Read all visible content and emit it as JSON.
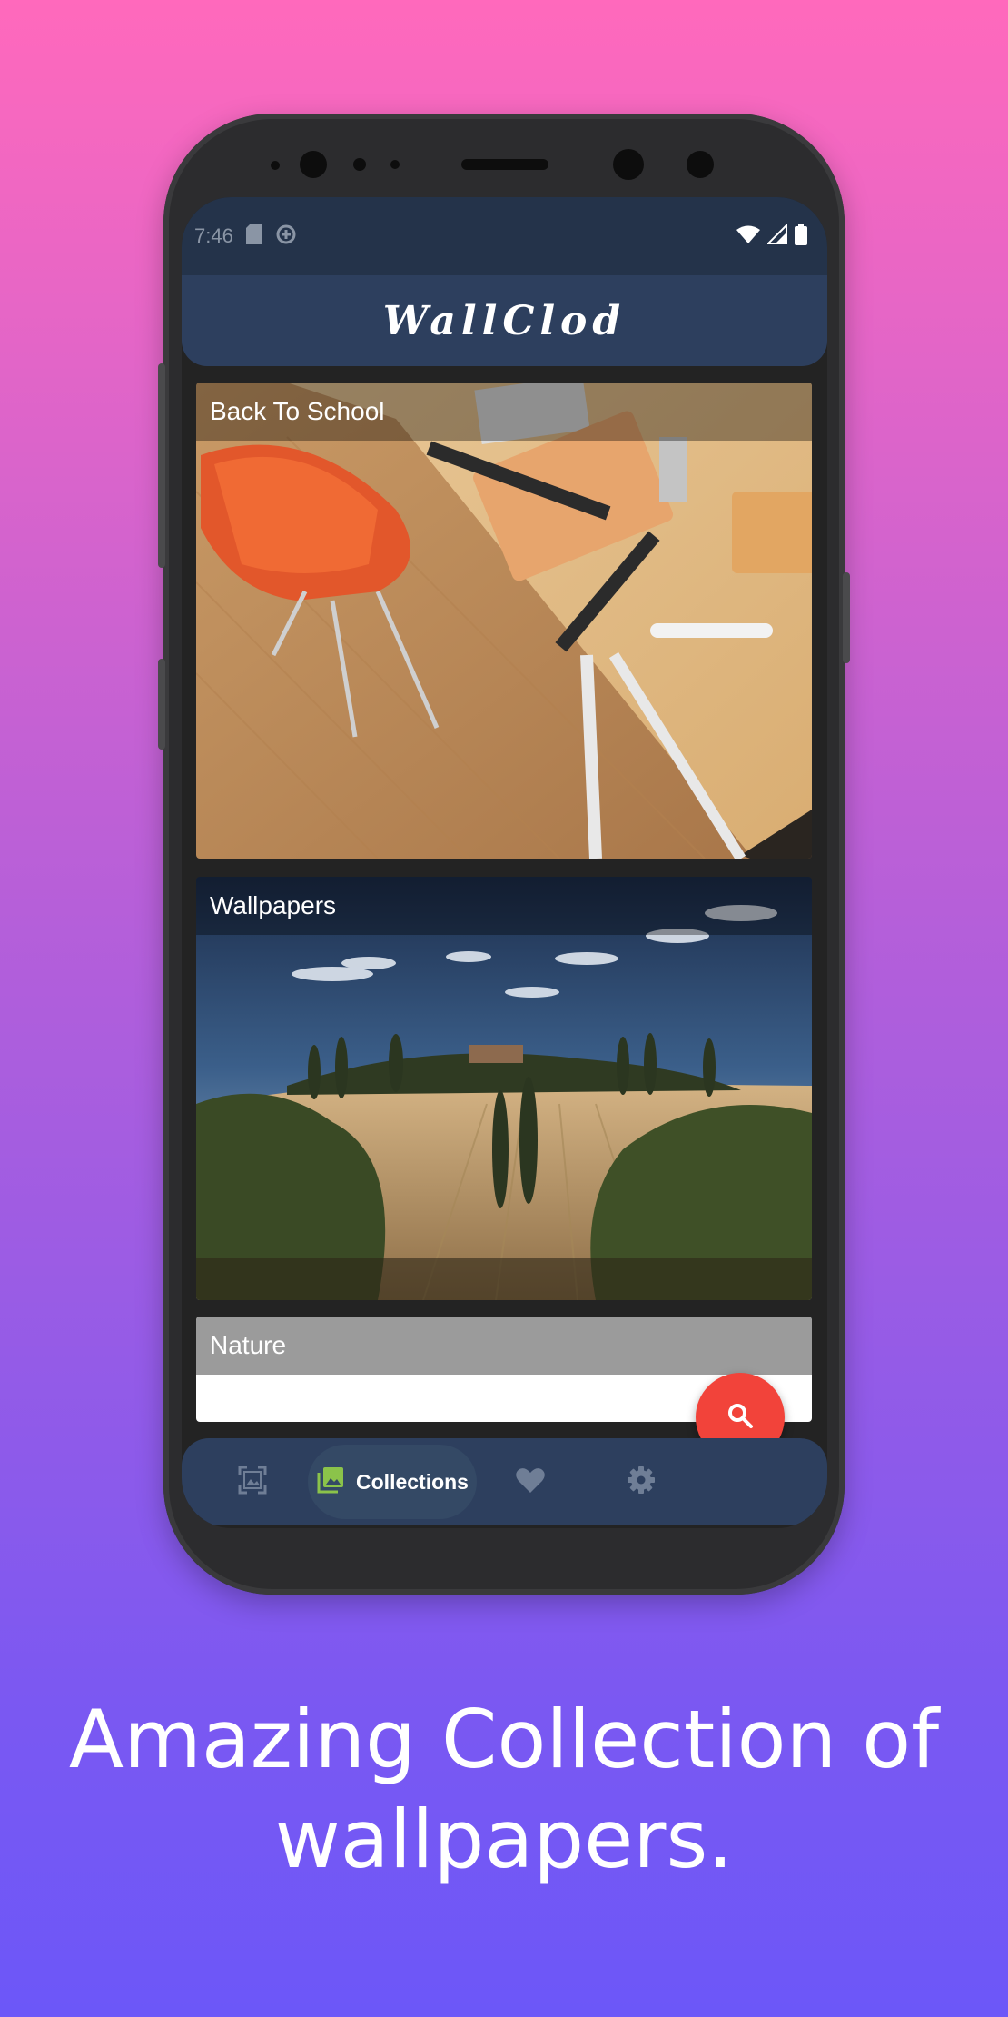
{
  "status_bar": {
    "time": "7:46",
    "left_icons": [
      "sim-card-icon",
      "data-saver-icon"
    ],
    "right_icons": [
      "wifi-icon",
      "cell-signal-icon",
      "battery-icon"
    ]
  },
  "app_bar": {
    "title": "WallClod"
  },
  "collections": [
    {
      "label": "Back To School"
    },
    {
      "label": "Wallpapers"
    },
    {
      "label": "Nature"
    }
  ],
  "fab": {
    "icon": "search-icon"
  },
  "bottom_nav": {
    "items": [
      {
        "id": "photos",
        "icon": "image-frame-icon",
        "label": ""
      },
      {
        "id": "collections",
        "icon": "collections-icon",
        "label": "Collections",
        "active": true
      },
      {
        "id": "favorites",
        "icon": "heart-icon",
        "label": ""
      },
      {
        "id": "settings",
        "icon": "gear-icon",
        "label": ""
      }
    ],
    "active_color": "#8bc34a"
  },
  "caption": "Amazing Collection of wallpapers.",
  "colors": {
    "gradient_top": "#ff69bc",
    "gradient_bottom": "#6c57f8",
    "app_bar": "#2d3f5e",
    "fab": "#f2433a"
  }
}
